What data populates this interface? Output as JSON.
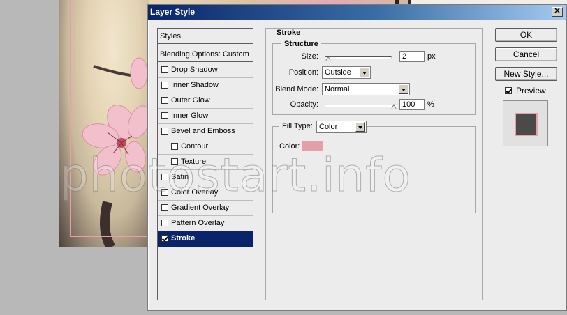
{
  "window": {
    "title": "Layer Style",
    "close_glyph": "✕"
  },
  "styles_panel": {
    "header": "Styles",
    "blending_options": "Blending Options: Custom",
    "items": [
      {
        "label": "Drop Shadow",
        "checked": false,
        "indent": false,
        "selected": false
      },
      {
        "label": "Inner Shadow",
        "checked": false,
        "indent": false,
        "selected": false
      },
      {
        "label": "Outer Glow",
        "checked": false,
        "indent": false,
        "selected": false
      },
      {
        "label": "Inner Glow",
        "checked": false,
        "indent": false,
        "selected": false
      },
      {
        "label": "Bevel and Emboss",
        "checked": false,
        "indent": false,
        "selected": false
      },
      {
        "label": "Contour",
        "checked": false,
        "indent": true,
        "selected": false
      },
      {
        "label": "Texture",
        "checked": false,
        "indent": true,
        "selected": false
      },
      {
        "label": "Satin",
        "checked": false,
        "indent": false,
        "selected": false
      },
      {
        "label": "Color Overlay",
        "checked": false,
        "indent": false,
        "selected": false
      },
      {
        "label": "Gradient Overlay",
        "checked": false,
        "indent": false,
        "selected": false
      },
      {
        "label": "Pattern Overlay",
        "checked": false,
        "indent": false,
        "selected": false
      },
      {
        "label": "Stroke",
        "checked": true,
        "indent": false,
        "selected": true
      }
    ]
  },
  "stroke": {
    "group_title": "Stroke",
    "structure": {
      "title": "Structure",
      "size_label": "Size:",
      "size_value": "2",
      "size_unit": "px",
      "size_level": 0.0,
      "position_label": "Position:",
      "position_value": "Outside",
      "blend_label": "Blend Mode:",
      "blend_value": "Normal",
      "opacity_label": "Opacity:",
      "opacity_value": "100",
      "opacity_unit": "%",
      "opacity_level": 1.0
    },
    "fill": {
      "type_label": "Fill Type:",
      "type_value": "Color",
      "color_label": "Color:",
      "color_hex": "#e3a0a8"
    }
  },
  "buttons": {
    "ok": "OK",
    "cancel": "Cancel",
    "new_style": "New Style..."
  },
  "preview": {
    "label": "Preview",
    "checked": true,
    "stroke_color": "#e8a0a8",
    "fill_color": "#4a4a4a"
  },
  "watermark": "photostart.info",
  "colors": {
    "accent": "#0a246a",
    "dialog_bg": "#ececec"
  }
}
